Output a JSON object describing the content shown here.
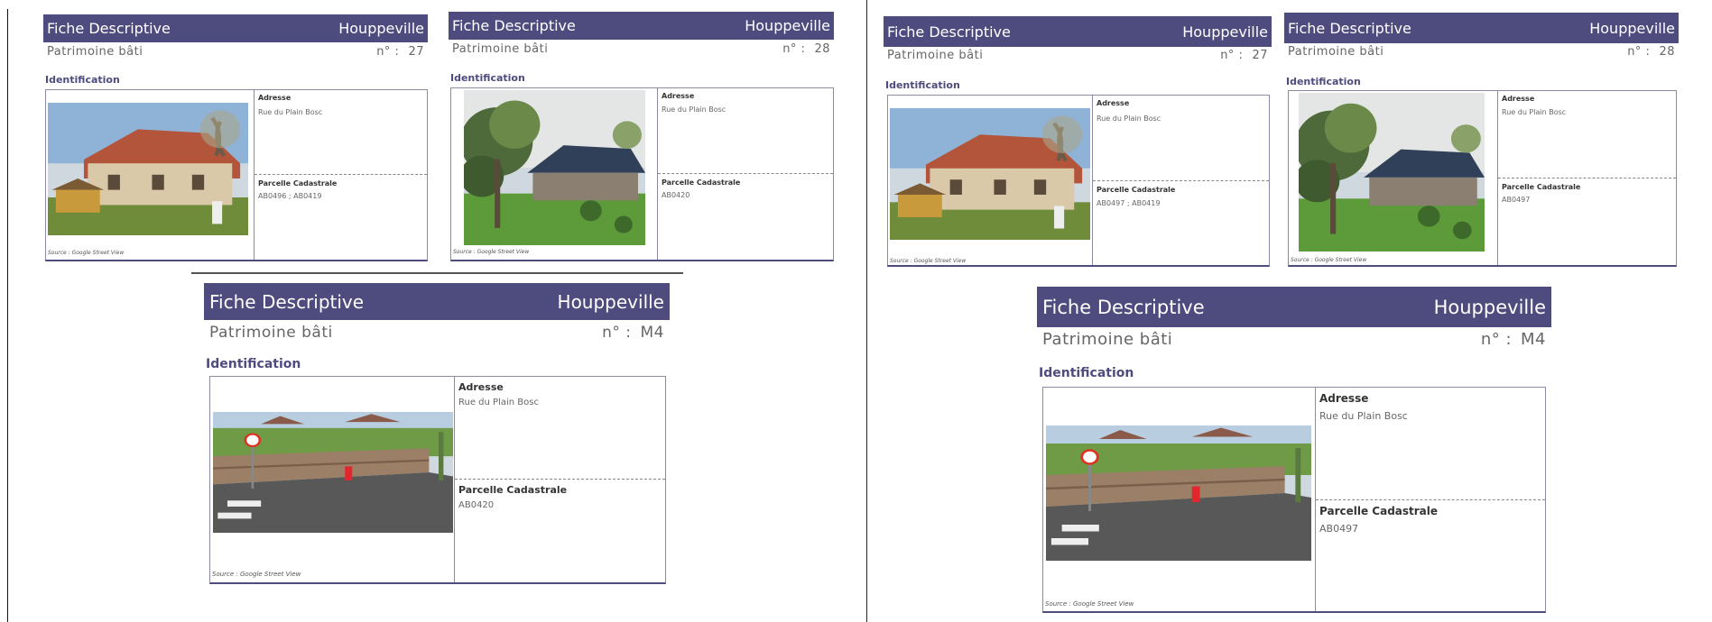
{
  "common": {
    "title": "Fiche Descriptive",
    "town": "Houppeville",
    "subtitle": "Patrimoine bâti",
    "num_label": "n° :",
    "ident": "Identification",
    "adresse_label": "Adresse",
    "parcelle_label": "Parcelle Cadastrale",
    "source": "Source : Google Street View"
  },
  "cards": [
    {
      "num": "27",
      "adresse": "Rue du Plain Bosc",
      "parcelle": "AB0496 ; AB0419"
    },
    {
      "num": "28",
      "adresse": "Rue du Plain Bosc",
      "parcelle": "AB0420"
    },
    {
      "num": "M4",
      "adresse": "Rue du Plain Bosc",
      "parcelle": "AB0420"
    },
    {
      "num": "27",
      "adresse": "Rue du Plain Bosc",
      "parcelle": "AB0497 ; AB0419"
    },
    {
      "num": "28",
      "adresse": "Rue du Plain Bosc",
      "parcelle": "AB0497"
    },
    {
      "num": "M4",
      "adresse": "Rue du Plain Bosc",
      "parcelle": "AB0497"
    }
  ],
  "colors": {
    "header_bg": "#4e4c7e",
    "accent": "#4e4c7e"
  }
}
